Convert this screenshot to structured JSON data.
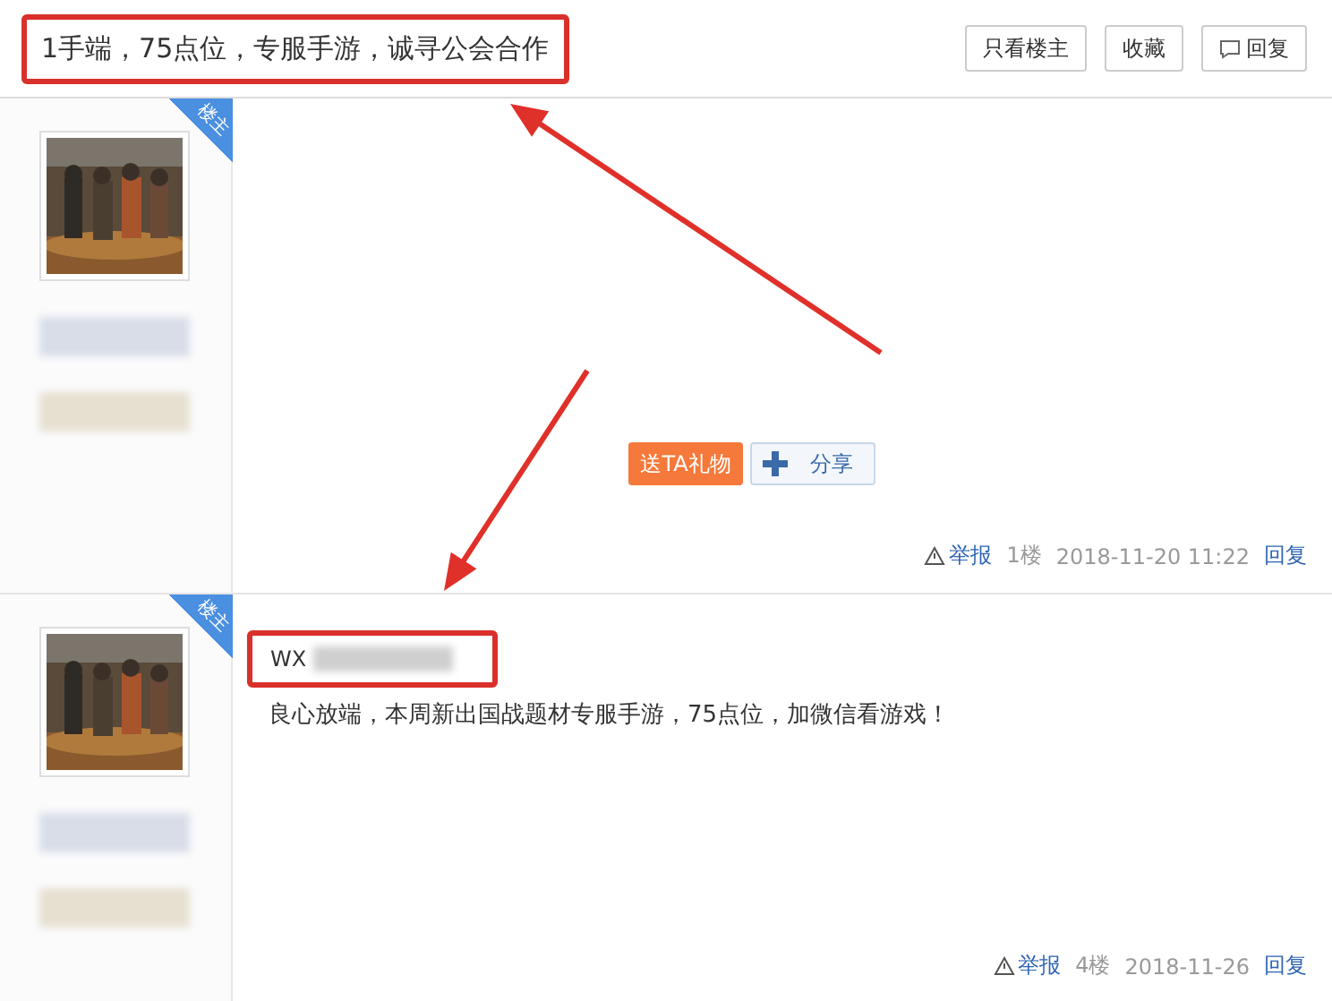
{
  "thread": {
    "title": "1手端，75点位，专服手游，诚寻公会合作",
    "highlighted": true,
    "actions": [
      {
        "label": "只看楼主",
        "icon": false
      },
      {
        "label": "收藏",
        "icon": false
      },
      {
        "label": "回复",
        "icon": true
      }
    ]
  },
  "posts": [
    {
      "badge": "楼主",
      "gift_button": "送TA礼物",
      "share_button": "分享",
      "footer": {
        "report": "举报",
        "floor": "1楼",
        "time": "2018-11-20 11:22",
        "reply": "回复"
      }
    },
    {
      "badge": "楼主",
      "contact": {
        "label": "WX",
        "highlighted": true
      },
      "content": "良心放端，本周新出国战题材专服手游，75点位，加微信看游戏！",
      "footer": {
        "report": "举报",
        "floor": "4楼",
        "time": "2018-11-26",
        "reply": "回复"
      }
    }
  ]
}
